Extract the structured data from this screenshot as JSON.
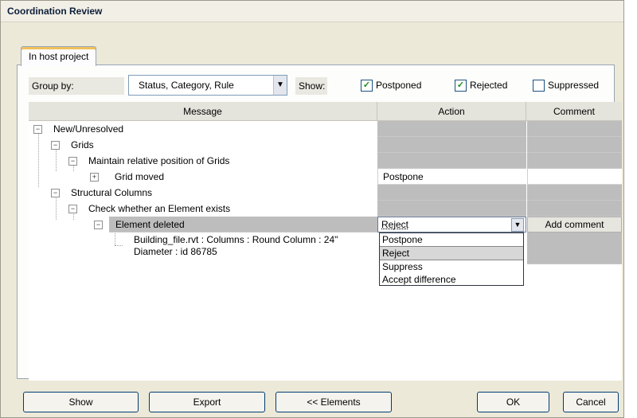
{
  "window": {
    "title": "Coordination Review"
  },
  "tabs": [
    {
      "label": "In host project"
    }
  ],
  "toolbar": {
    "group_by_label": "Group by:",
    "group_by_value": "Status, Category, Rule",
    "show_label": "Show:",
    "filters": [
      {
        "label": "Postponed",
        "checked": true
      },
      {
        "label": "Rejected",
        "checked": true
      },
      {
        "label": "Suppressed",
        "checked": false
      }
    ]
  },
  "grid": {
    "columns": [
      "Message",
      "Action",
      "Comment"
    ],
    "rows": [
      {
        "label": "New/Unresolved",
        "action": "",
        "comment": ""
      },
      {
        "label": "Grids",
        "action": "",
        "comment": ""
      },
      {
        "label": "Maintain relative position of Grids",
        "action": "",
        "comment": ""
      },
      {
        "label": "Grid moved",
        "action": "Postpone",
        "comment": ""
      },
      {
        "label": "Structural Columns",
        "action": "",
        "comment": ""
      },
      {
        "label": "Check whether an Element exists",
        "action": "",
        "comment": ""
      },
      {
        "label": "Element deleted",
        "action": "Reject",
        "comment": "Add comment"
      },
      {
        "label": "Building_file.rvt : Columns : Round Column : 24\"",
        "label2": "Diameter : id 86785",
        "action": "",
        "comment": ""
      }
    ]
  },
  "action_dropdown": {
    "options": [
      "Postpone",
      "Reject",
      "Suppress",
      "Accept difference"
    ],
    "selected": "Reject"
  },
  "buttons": {
    "show": "Show",
    "export": "Export",
    "elements": "<< Elements",
    "ok": "OK",
    "cancel": "Cancel"
  }
}
